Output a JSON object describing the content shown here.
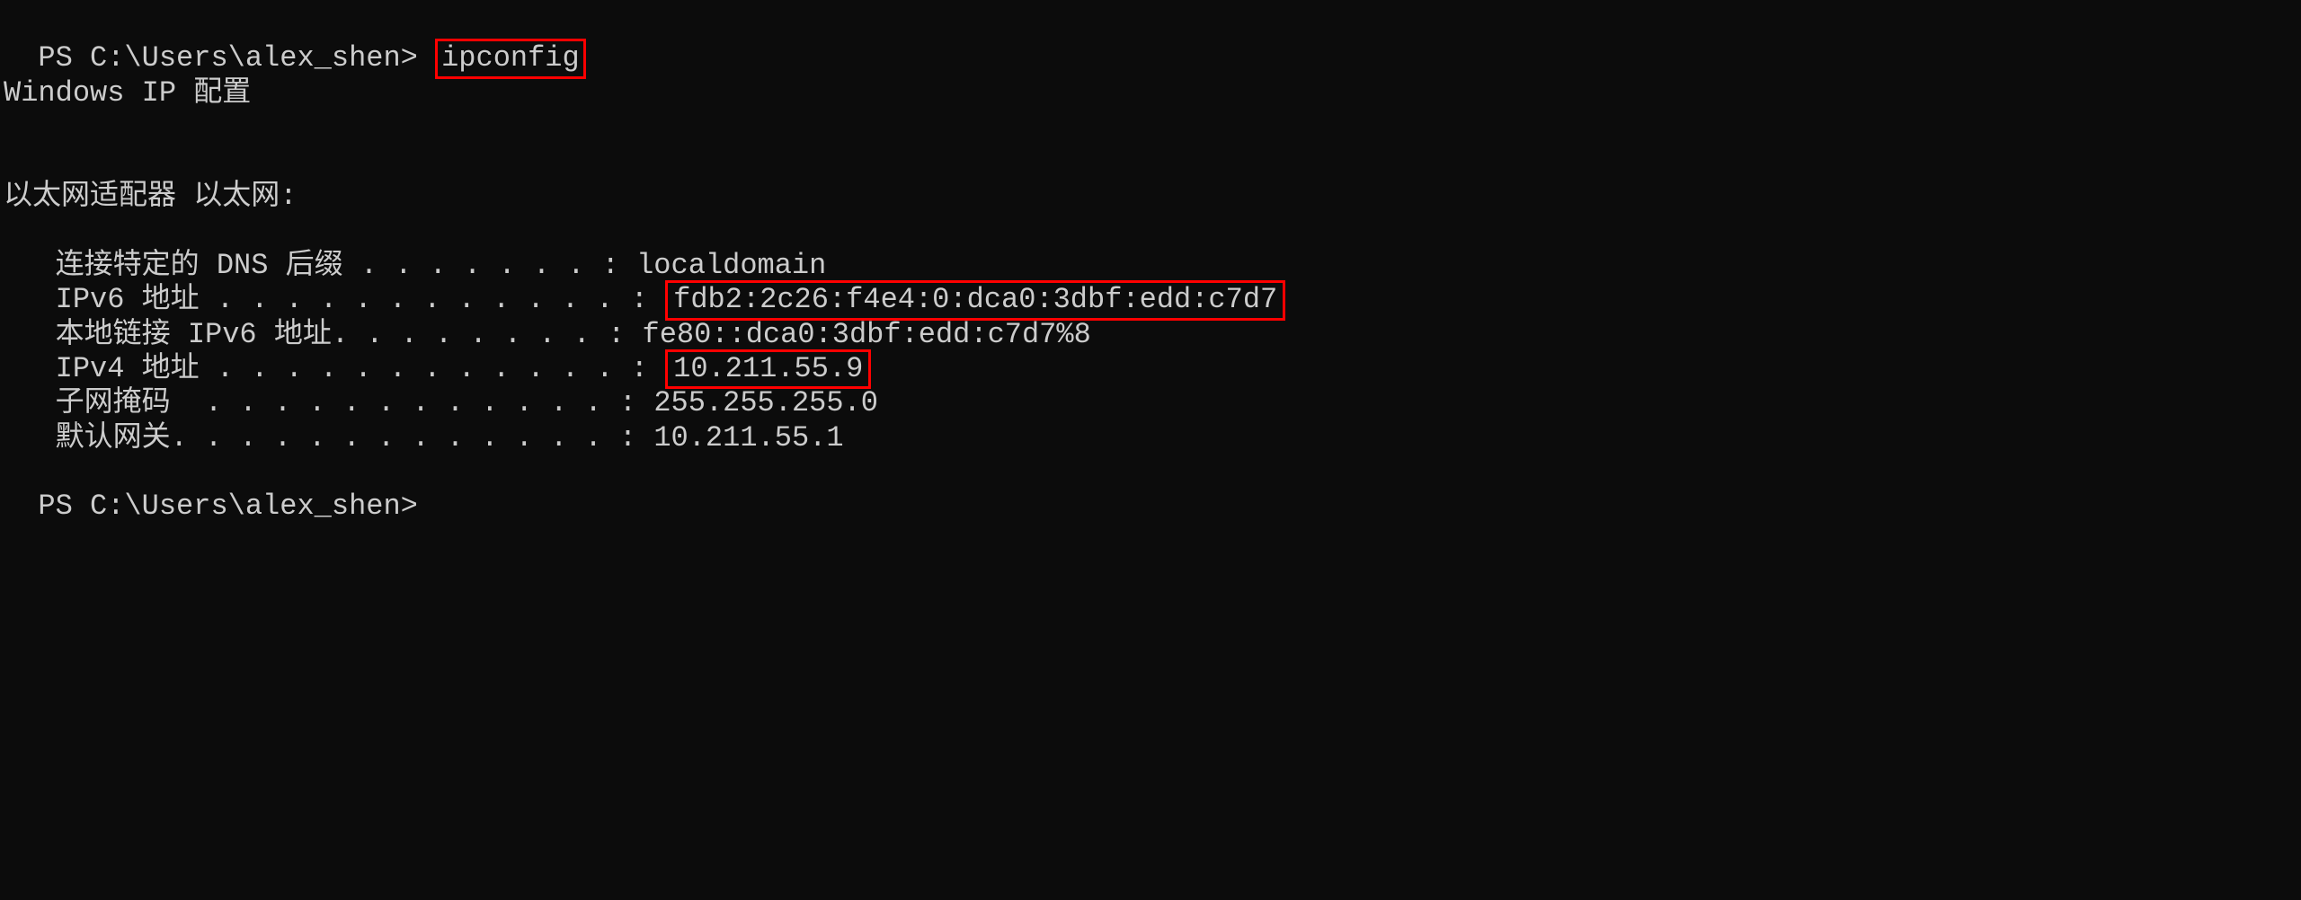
{
  "prompt1_prefix": "PS C:\\Users\\alex_shen> ",
  "command": "ipconfig",
  "blank": "",
  "heading": "Windows IP 配置",
  "adapter_heading": "以太网适配器 以太网:",
  "rows": {
    "dns_suffix": {
      "label": "   连接特定的 DNS 后缀 . . . . . . . : ",
      "value": "localdomain"
    },
    "ipv6": {
      "label": "   IPv6 地址 . . . . . . . . . . . . : ",
      "value": "fdb2:2c26:f4e4:0:dca0:3dbf:edd:c7d7"
    },
    "link_local_ipv6": {
      "label": "   本地链接 IPv6 地址. . . . . . . . : ",
      "value": "fe80::dca0:3dbf:edd:c7d7%8"
    },
    "ipv4": {
      "label": "   IPv4 地址 . . . . . . . . . . . . : ",
      "value": "10.211.55.9"
    },
    "subnet": {
      "label": "   子网掩码  . . . . . . . . . . . . : ",
      "value": "255.255.255.0"
    },
    "gateway": {
      "label": "   默认网关. . . . . . . . . . . . . : ",
      "value": "10.211.55.1"
    }
  },
  "prompt2": "PS C:\\Users\\alex_shen> "
}
